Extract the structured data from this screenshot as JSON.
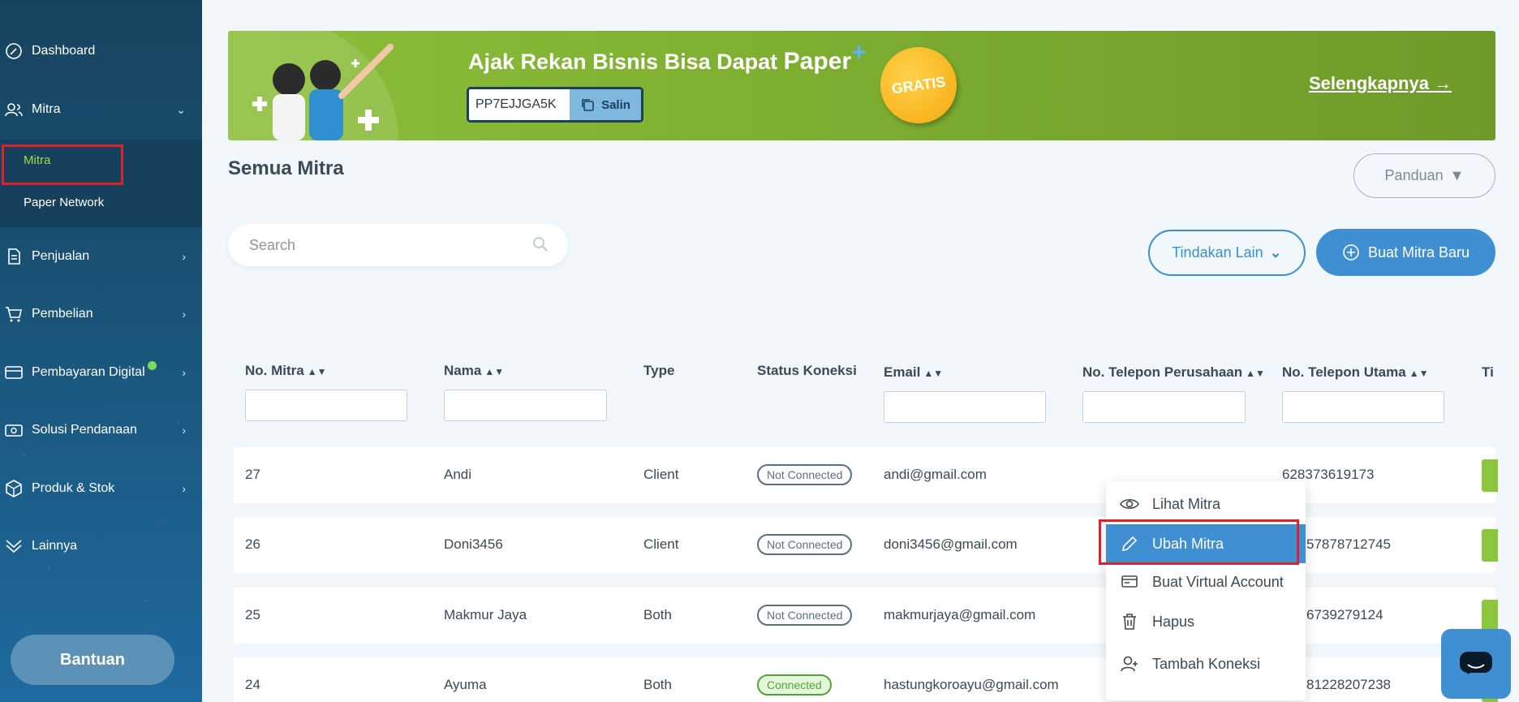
{
  "sidebar": {
    "items": [
      {
        "label": "Dashboard",
        "icon": "dashboard-icon"
      },
      {
        "label": "Mitra",
        "icon": "partner-icon"
      },
      {
        "label": "Penjualan",
        "icon": "sales-icon"
      },
      {
        "label": "Pembelian",
        "icon": "cart-icon"
      },
      {
        "label": "Pembayaran Digital",
        "icon": "digital-payment-icon"
      },
      {
        "label": "Solusi Pendanaan",
        "icon": "funding-icon"
      },
      {
        "label": "Produk & Stok",
        "icon": "box-icon"
      },
      {
        "label": "Lainnya",
        "icon": "more-icon"
      }
    ],
    "submenu": [
      {
        "label": "Mitra"
      },
      {
        "label": "Paper Network"
      }
    ],
    "help_label": "Bantuan"
  },
  "banner": {
    "title": "Ajak Rekan Bisnis Bisa Dapat",
    "brand": "Paper",
    "code": "PP7EJJGA5K",
    "copy_label": "Salin",
    "badge": "GRATIS",
    "more_label": "Selengkapnya"
  },
  "page": {
    "title": "Semua Mitra",
    "guide_label": "Panduan",
    "search_placeholder": "Search",
    "other_actions_label": "Tindakan Lain",
    "new_button_label": "Buat Mitra Baru"
  },
  "table": {
    "columns": [
      {
        "label": "No. Mitra"
      },
      {
        "label": "Nama"
      },
      {
        "label": "Type"
      },
      {
        "label": "Status Koneksi"
      },
      {
        "label": "Email"
      },
      {
        "label": "No. Telepon Perusahaan"
      },
      {
        "label": "No. Telepon Utama"
      },
      {
        "label": "Ti"
      }
    ],
    "rows": [
      {
        "no": "27",
        "name": "Andi",
        "type": "Client",
        "status": "Not Connected",
        "email": "andi@gmail.com",
        "phone": "628373619173"
      },
      {
        "no": "26",
        "name": "Doni3456",
        "type": "Client",
        "status": "Not Connected",
        "email": "doni3456@gmail.com",
        "phone": "57878712745"
      },
      {
        "no": "25",
        "name": "Makmur Jaya",
        "type": "Both",
        "status": "Not Connected",
        "email": "makmurjaya@gmail.com",
        "phone": "6739279124"
      },
      {
        "no": "24",
        "name": "Ayuma",
        "type": "Both",
        "status": "Connected",
        "email": "hastungkoroayu@gmail.com",
        "phone": "81228207238"
      }
    ]
  },
  "menu": {
    "items": [
      {
        "label": "Lihat Mitra",
        "icon": "eye-icon"
      },
      {
        "label": "Ubah Mitra",
        "icon": "pencil-icon"
      },
      {
        "label": "Buat Virtual Account",
        "icon": "card-icon"
      },
      {
        "label": "Hapus",
        "icon": "trash-icon"
      },
      {
        "label": "Tambah Koneksi",
        "icon": "add-user-icon"
      }
    ]
  },
  "colors": {
    "accent": "#3f8fd2",
    "active_menu": "#3f8fd2",
    "highlight": "#d9252a",
    "sidebar_active": "#9fdc4a"
  }
}
